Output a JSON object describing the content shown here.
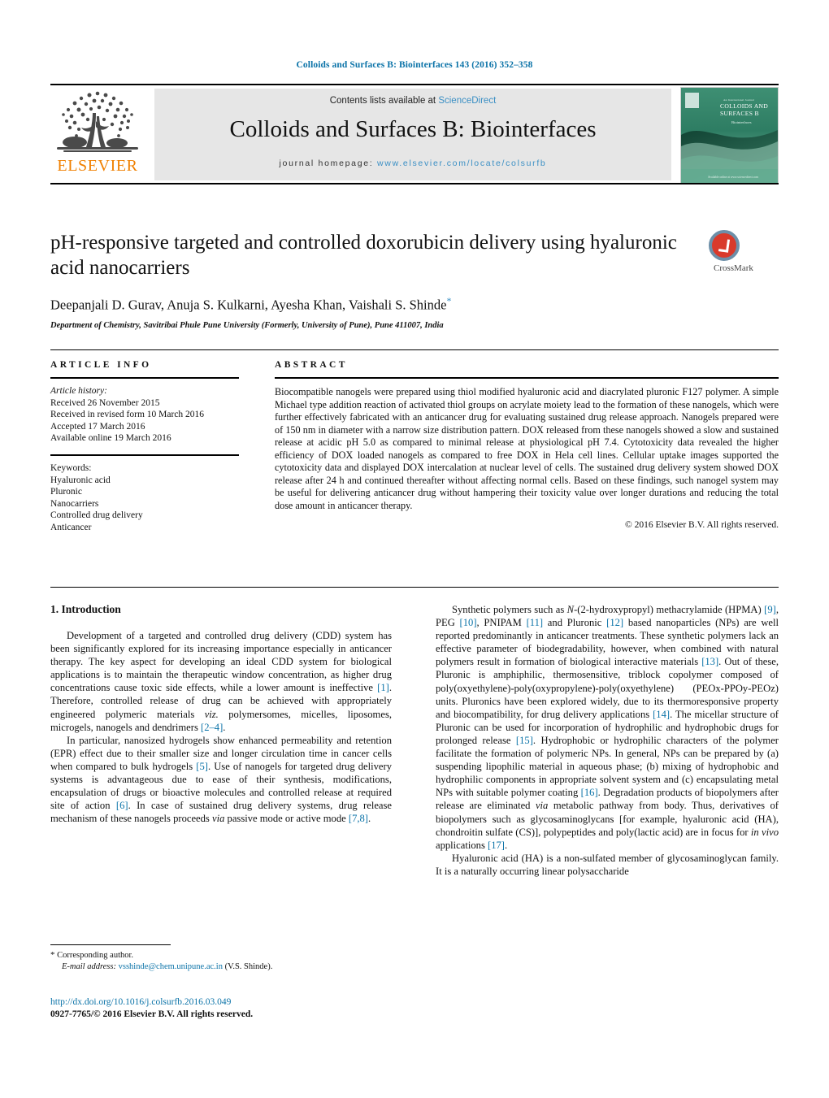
{
  "running_head": "Colloids and Surfaces B: Biointerfaces 143 (2016) 352–358",
  "masthead": {
    "publisher_name": "ELSEVIER",
    "contents_prefix": "Contents lists available at ",
    "contents_link": "ScienceDirect",
    "journal_title": "Colloids and Surfaces B: Biointerfaces",
    "homepage_prefix": "journal homepage: ",
    "homepage_url": "www.elsevier.com/locate/colsurfb",
    "cover": {
      "top_small": "An International Journal",
      "title_line1": "COLLOIDS AND",
      "title_line2": "SURFACES B",
      "subtitle": "Biointerfaces",
      "footer": "Available online at www.sciencedirect.com"
    }
  },
  "article": {
    "title": "pH-responsive targeted and controlled doxorubicin delivery using hyaluronic acid nanocarriers",
    "authors": "Deepanjali D. Gurav, Anuja S. Kulkarni, Ayesha Khan, Vaishali S. Shinde",
    "author_star": "*",
    "affiliation": "Department of Chemistry, Savitribai Phule Pune University (Formerly, University of Pune), Pune 411007, India",
    "crossmark_label": "CrossMark"
  },
  "article_info": {
    "heading": "ARTICLE INFO",
    "history_label": "Article history:",
    "history": [
      "Received 26 November 2015",
      "Received in revised form 10 March 2016",
      "Accepted 17 March 2016",
      "Available online 19 March 2016"
    ],
    "keywords_label": "Keywords:",
    "keywords": [
      "Hyaluronic acid",
      "Pluronic",
      "Nanocarriers",
      "Controlled drug delivery",
      "Anticancer"
    ]
  },
  "abstract": {
    "heading": "ABSTRACT",
    "text": "Biocompatible nanogels were prepared using thiol modified hyaluronic acid and diacrylated pluronic F127 polymer. A simple Michael type addition reaction of activated thiol groups on acrylate moiety lead to the formation of these nanogels, which were further effectively fabricated with an anticancer drug for evaluating sustained drug release approach. Nanogels prepared were of 150 nm in diameter with a narrow size distribution pattern. DOX released from these nanogels showed a slow and sustained release at acidic pH 5.0 as compared to minimal release at physiological pH 7.4. Cytotoxicity data revealed the higher efficiency of DOX loaded nanogels as compared to free DOX in Hela cell lines. Cellular uptake images supported the cytotoxicity data and displayed DOX intercalation at nuclear level of cells. The sustained drug delivery system showed DOX release after 24 h and continued thereafter without affecting normal cells. Based on these findings, such nanogel system may be useful for delivering anticancer drug without hampering their toxicity value over longer durations and reducing the total dose amount in anticancer therapy.",
    "copyright": "© 2016 Elsevier B.V. All rights reserved."
  },
  "introduction": {
    "heading": "1. Introduction",
    "left_paragraphs": [
      {
        "segments": [
          {
            "t": "Development of a targeted and controlled drug delivery (CDD) system has been significantly explored for its increasing importance especially in anticancer therapy. The key aspect for developing an ideal CDD system for biological applications is to maintain the therapeutic window concentration, as higher drug concentrations cause toxic side effects, while a lower amount is ineffective ",
            "s": "plain"
          },
          {
            "t": "[1]",
            "s": "ref"
          },
          {
            "t": ". Therefore, controlled release of drug can be achieved with appropriately engineered polymeric materials ",
            "s": "plain"
          },
          {
            "t": "viz.",
            "s": "italic"
          },
          {
            "t": " polymersomes, micelles, liposomes, microgels, nanogels and dendrimers ",
            "s": "plain"
          },
          {
            "t": "[2–4]",
            "s": "ref"
          },
          {
            "t": ".",
            "s": "plain"
          }
        ]
      },
      {
        "segments": [
          {
            "t": "In particular, nanosized hydrogels show enhanced permeability and retention (EPR) effect due to their smaller size and longer circulation time in cancer cells when compared to bulk hydrogels ",
            "s": "plain"
          },
          {
            "t": "[5]",
            "s": "ref"
          },
          {
            "t": ". Use of nanogels for targeted drug delivery systems is advantageous due to ease of their synthesis, modifications, encapsulation of drugs or bioactive molecules and controlled release at required site of action ",
            "s": "plain"
          },
          {
            "t": "[6]",
            "s": "ref"
          },
          {
            "t": ". In case of sustained drug delivery systems, drug release mechanism of these nanogels proceeds ",
            "s": "plain"
          },
          {
            "t": "via",
            "s": "italic"
          },
          {
            "t": " passive mode or active mode ",
            "s": "plain"
          },
          {
            "t": "[7,8]",
            "s": "ref"
          },
          {
            "t": ".",
            "s": "plain"
          }
        ]
      }
    ],
    "right_paragraphs": [
      {
        "segments": [
          {
            "t": "Synthetic polymers such as ",
            "s": "plain"
          },
          {
            "t": "N-",
            "s": "italic"
          },
          {
            "t": "(2-hydroxypropyl) methacrylamide (HPMA) ",
            "s": "plain"
          },
          {
            "t": "[9]",
            "s": "ref"
          },
          {
            "t": ", PEG ",
            "s": "plain"
          },
          {
            "t": "[10]",
            "s": "ref"
          },
          {
            "t": ", PNIPAM ",
            "s": "plain"
          },
          {
            "t": "[11]",
            "s": "ref"
          },
          {
            "t": " and Pluronic ",
            "s": "plain"
          },
          {
            "t": "[12]",
            "s": "ref"
          },
          {
            "t": " based nanoparticles (NPs) are well reported predominantly in anticancer treatments. These synthetic polymers lack an effective parameter of biodegradability, however, when combined with natural polymers result in formation of biological interactive materials ",
            "s": "plain"
          },
          {
            "t": "[13]",
            "s": "ref"
          },
          {
            "t": ". Out of these, Pluronic is amphiphilic, thermosensitive, triblock copolymer composed of poly(oxyethylene)-poly(oxypropylene)-poly(oxyethylene) (PEOx-PPOy-PEOz) units. Pluronics have been explored widely, due to its thermoresponsive property and biocompatibility, for drug delivery applications ",
            "s": "plain"
          },
          {
            "t": "[14]",
            "s": "ref"
          },
          {
            "t": ". The micellar structure of Pluronic can be used for incorporation of hydrophilic and hydrophobic drugs for prolonged release ",
            "s": "plain"
          },
          {
            "t": "[15]",
            "s": "ref"
          },
          {
            "t": ". Hydrophobic or hydrophilic characters of the polymer facilitate the formation of polymeric NPs. In general, NPs can be prepared by (a) suspending lipophilic material in aqueous phase; (b) mixing of hydrophobic and hydrophilic components in appropriate solvent system and (c) encapsulating metal NPs with suitable polymer coating ",
            "s": "plain"
          },
          {
            "t": "[16]",
            "s": "ref"
          },
          {
            "t": ". Degradation products of biopolymers after release are eliminated ",
            "s": "plain"
          },
          {
            "t": "via",
            "s": "italic"
          },
          {
            "t": " metabolic pathway from body. Thus, derivatives of biopolymers such as glycosaminoglycans [for example, hyaluronic acid (HA), chondroitin sulfate (CS)], polypeptides and poly(lactic acid) are in focus for ",
            "s": "plain"
          },
          {
            "t": "in vivo",
            "s": "italic"
          },
          {
            "t": " applications ",
            "s": "plain"
          },
          {
            "t": "[17]",
            "s": "ref"
          },
          {
            "t": ".",
            "s": "plain"
          }
        ]
      },
      {
        "segments": [
          {
            "t": "Hyaluronic acid (HA) is a non-sulfated member of glycosaminoglycan family. It is a naturally occurring linear polysaccharide",
            "s": "plain"
          }
        ]
      }
    ]
  },
  "footer": {
    "corresponding_star": "*",
    "corresponding_label": "Corresponding author.",
    "email_label": "E-mail address:",
    "email": "vsshinde@chem.unipune.ac.in",
    "email_owner": "(V.S. Shinde).",
    "doi": "http://dx.doi.org/10.1016/j.colsurfb.2016.03.049",
    "issn_line": "0927-7765/© 2016 Elsevier B.V. All rights reserved."
  }
}
